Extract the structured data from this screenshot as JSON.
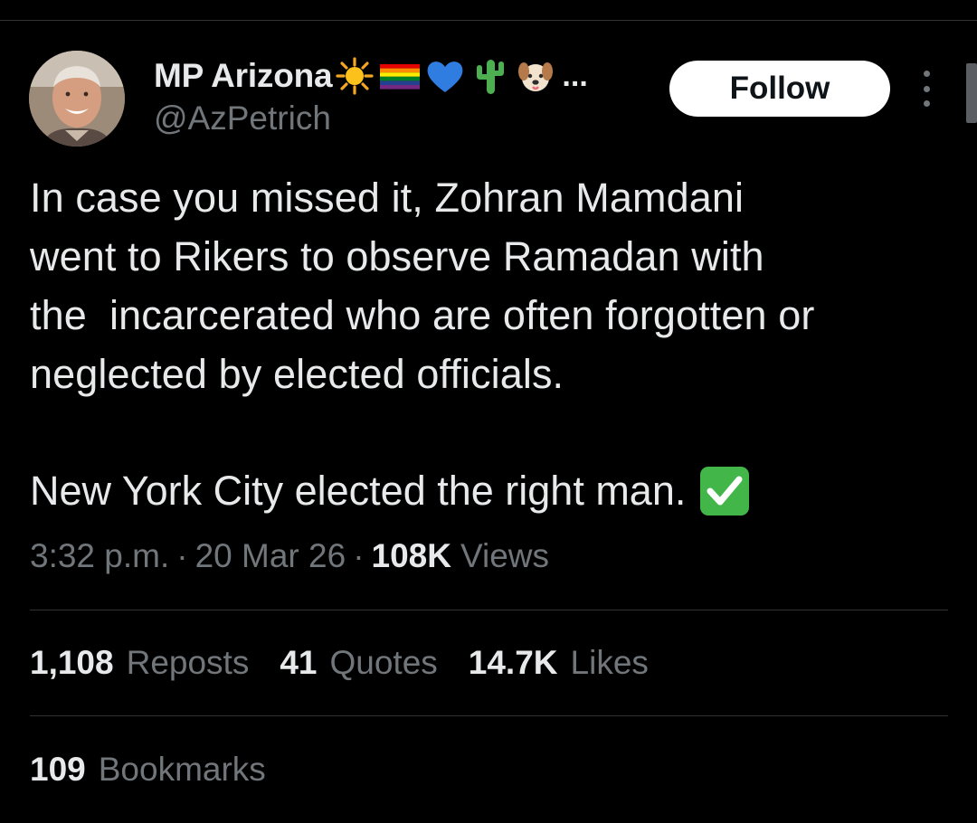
{
  "author": {
    "display_name": "MP Arizona",
    "name_truncation": "...",
    "handle": "@AzPetrich",
    "name_emojis": [
      "sun-emoji",
      "rainbow-flag-emoji",
      "blue-heart-emoji",
      "cactus-emoji",
      "dog-emoji"
    ]
  },
  "follow_button": {
    "label": "Follow"
  },
  "tweet": {
    "text": "In case you missed it, Zohran Mamdani\nwent to Rikers to observe Ramadan with\nthe  incarcerated who are often forgotten or\nneglected by elected officials.",
    "text_2": "New York City elected the right man.",
    "trailing_emoji": "check-mark-button-emoji"
  },
  "meta": {
    "time": "3:32 p.m.",
    "separator": "·",
    "date": "20 Mar 26",
    "views_count": "108K",
    "views_label": "Views"
  },
  "stats": [
    {
      "count": "1,108",
      "label": "Reposts"
    },
    {
      "count": "41",
      "label": "Quotes"
    },
    {
      "count": "14.7K",
      "label": "Likes"
    }
  ],
  "bookmarks": {
    "count": "109",
    "label": "Bookmarks"
  },
  "colors": {
    "background": "#000000",
    "primary_text": "#e7e9ea",
    "secondary_text": "#71767b",
    "divider": "#2f3336",
    "follow_bg": "#ffffff"
  }
}
